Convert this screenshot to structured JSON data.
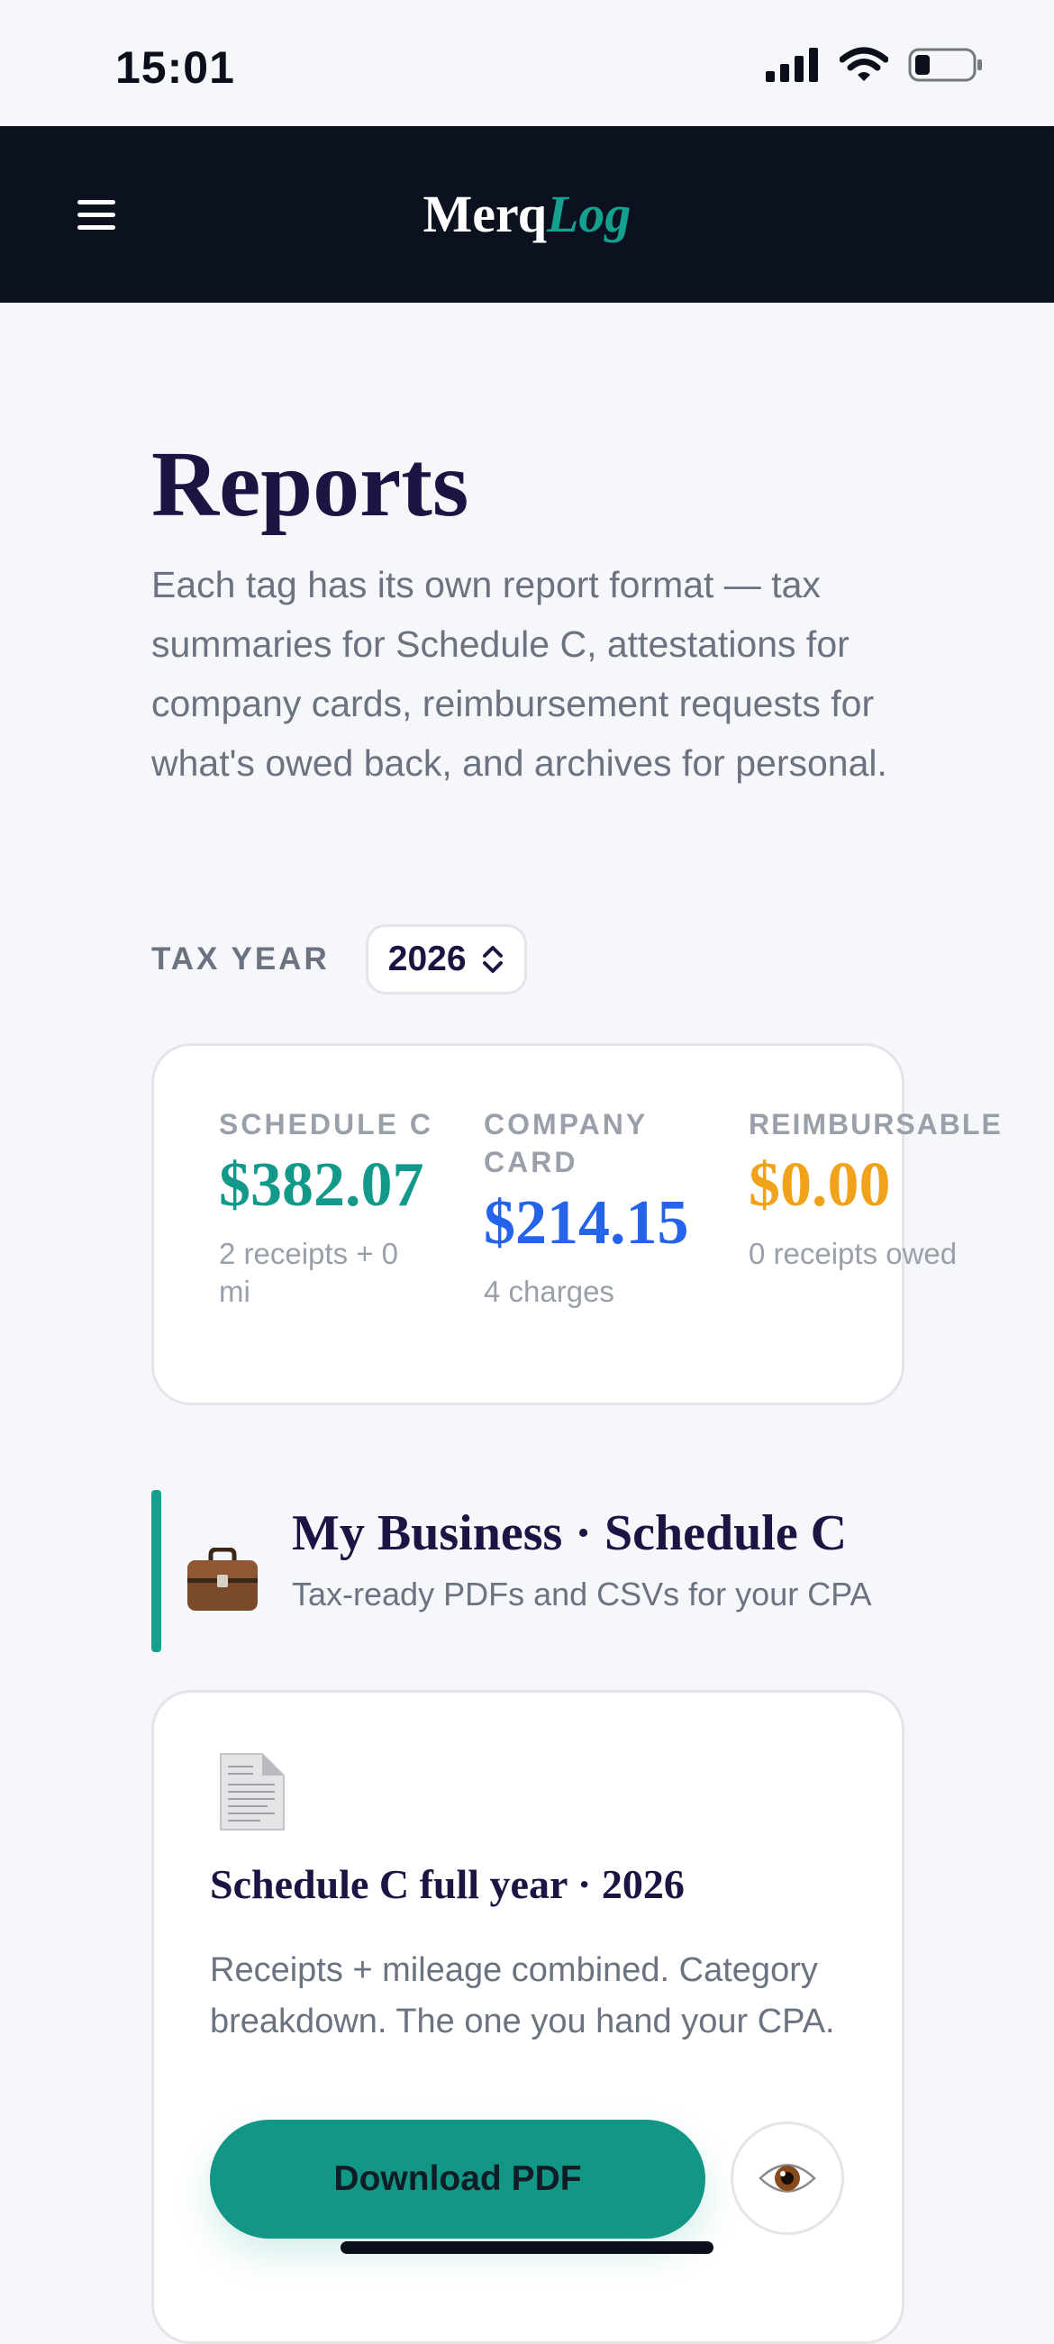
{
  "status_bar": {
    "time": "15:01"
  },
  "header": {
    "brand_main": "Merq",
    "brand_accent": "Log"
  },
  "page": {
    "title": "Reports",
    "intro": "Each tag has its own report format — tax summaries for Schedule C, attestations for company cards, reimbursement requests for what's owed back, and archives for personal."
  },
  "tax_year": {
    "label": "TAX YEAR",
    "value": "2026"
  },
  "summary": [
    {
      "label": "SCHEDULE C",
      "value": "$382.07",
      "sub": "2 receipts + 0 mi",
      "color": "#13998a"
    },
    {
      "label": "COMPANY CARD",
      "value": "$214.15",
      "sub": "4 charges",
      "color": "#2563eb"
    },
    {
      "label": "REIMBURSABLE",
      "value": "$0.00",
      "sub": "0 receipts owed",
      "color": "#f0a21a"
    }
  ],
  "section": {
    "title": "My Business · Schedule C",
    "subtitle": "Tax-ready PDFs and CSVs for your CPA",
    "icon": "briefcase-icon",
    "accent": "#14a190"
  },
  "report": {
    "icon": "document-icon",
    "title": "Schedule C full year · 2026",
    "description": "Receipts + mileage combined. Category breakdown. The one you hand your CPA.",
    "download_label": "Download PDF",
    "preview_icon": "eye-icon"
  }
}
